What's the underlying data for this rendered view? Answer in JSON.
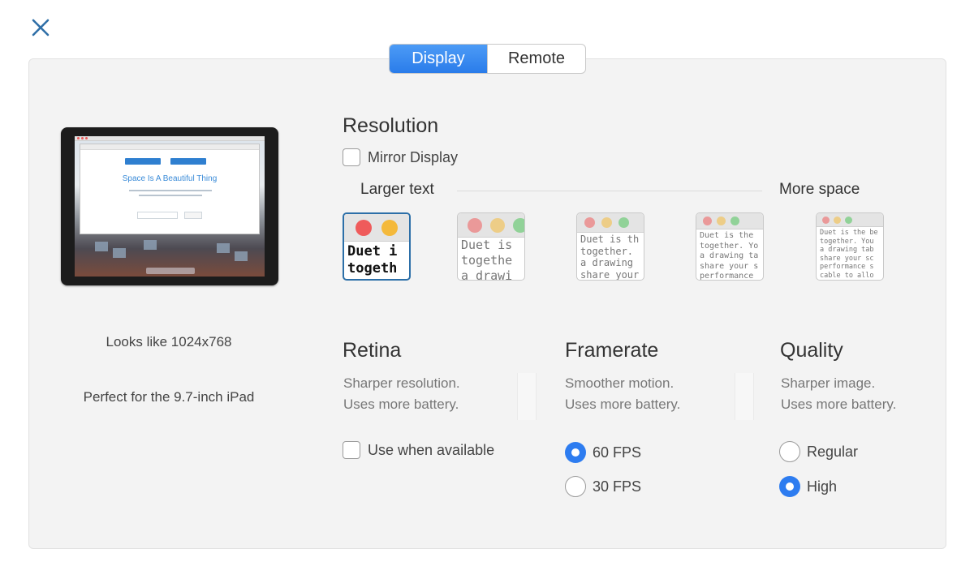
{
  "close_icon": "close-icon",
  "tabs": [
    {
      "label": "Display",
      "active": true
    },
    {
      "label": "Remote",
      "active": false
    }
  ],
  "preview": {
    "headline": "Space Is A Beautiful Thing",
    "caption_resolution": "Looks like 1024x768",
    "caption_device": "Perfect for the 9.7-inch iPad"
  },
  "resolution": {
    "title": "Resolution",
    "mirror_label": "Mirror Display",
    "mirror_checked": false,
    "scale_left": "Larger text",
    "scale_right": "More space",
    "options": [
      {
        "lines": [
          "Duet i",
          "togeth"
        ],
        "selected": true
      },
      {
        "lines": [
          "Duet is",
          "togethe",
          "a drawi"
        ],
        "selected": false
      },
      {
        "lines": [
          "Duet is th",
          "together.",
          "a drawing",
          "share your"
        ],
        "selected": false
      },
      {
        "lines": [
          "Duet is the",
          "together. Yo",
          "a drawing ta",
          "share your s",
          "performance"
        ],
        "selected": false
      },
      {
        "lines": [
          "Duet is the be",
          "together. You",
          "a drawing tab",
          "share your sc",
          "performance s",
          "cable to allo"
        ],
        "selected": false
      }
    ]
  },
  "retina": {
    "title": "Retina",
    "desc_line1": "Sharper resolution.",
    "desc_line2": "Uses more battery.",
    "checkbox_label": "Use when available",
    "checked": false
  },
  "framerate": {
    "title": "Framerate",
    "desc_line1": "Smoother motion.",
    "desc_line2": "Uses more battery.",
    "options": [
      {
        "label": "60 FPS",
        "selected": true
      },
      {
        "label": "30 FPS",
        "selected": false
      }
    ]
  },
  "quality": {
    "title": "Quality",
    "desc_line1": "Sharper image.",
    "desc_line2": "Uses more battery.",
    "options": [
      {
        "label": "Regular",
        "selected": false
      },
      {
        "label": "High",
        "selected": true
      }
    ]
  },
  "colors": {
    "accent": "#2d7cf0",
    "selected_border": "#2c6fa8",
    "panel_bg": "#f3f3f3"
  }
}
